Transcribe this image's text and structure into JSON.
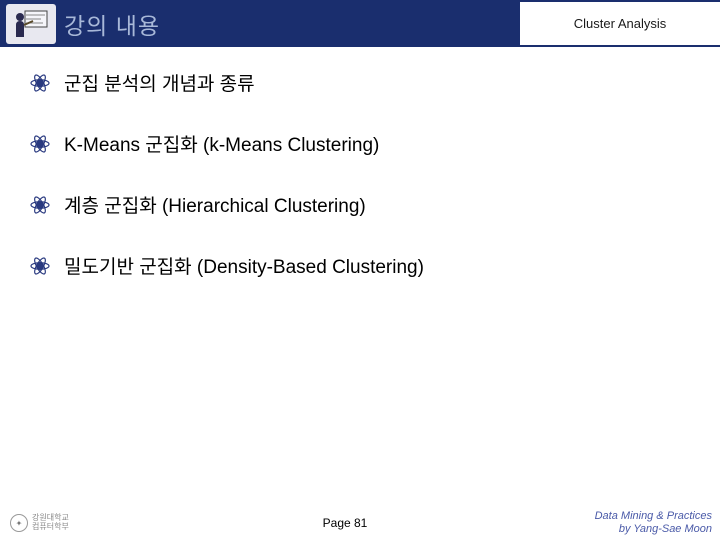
{
  "header": {
    "title": "강의 내용",
    "subtitle": "Cluster Analysis"
  },
  "bullets": [
    {
      "text": "군집 분석의 개념과 종류"
    },
    {
      "text": "K-Means 군집화 (k-Means Clustering)"
    },
    {
      "text": "계층 군집화 (Hierarchical Clustering)"
    },
    {
      "text": "밀도기반 군집화 (Density-Based Clustering)"
    }
  ],
  "footer": {
    "logo_text_line1": "강원대학교",
    "logo_text_line2": "컴퓨터학부",
    "page": "Page 81",
    "credit_line1": "Data Mining & Practices",
    "credit_line2": "by Yang-Sae Moon"
  },
  "colors": {
    "banner": "#1a2e6e",
    "title_text": "#a8b8d8",
    "credit": "#4a5aa8"
  }
}
